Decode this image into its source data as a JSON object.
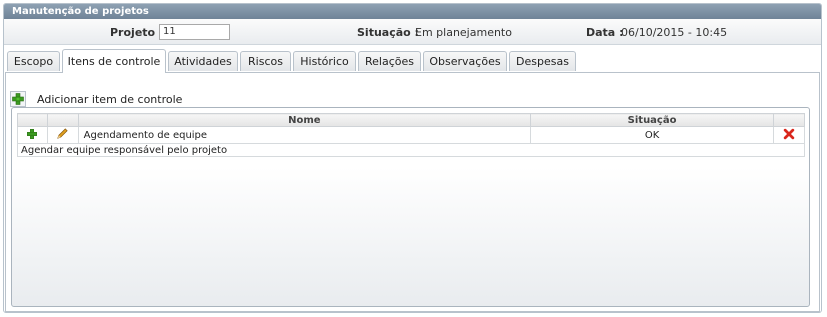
{
  "window": {
    "title": "Manutenção de projetos"
  },
  "info": {
    "projeto_label": "Projeto :",
    "projeto_value": "11",
    "situacao_label": "Situação :",
    "situacao_value": "Em planejamento",
    "data_label": "Data :",
    "data_value": "06/10/2015 - 10:45"
  },
  "tabs": [
    {
      "label": "Escopo"
    },
    {
      "label": "Itens de controle",
      "active": true
    },
    {
      "label": "Atividades"
    },
    {
      "label": "Riscos"
    },
    {
      "label": "Histórico"
    },
    {
      "label": "Relações"
    },
    {
      "label": "Observações"
    },
    {
      "label": "Despesas"
    }
  ],
  "toolbar": {
    "add_label": "Adicionar item de controle"
  },
  "table": {
    "headers": {
      "nome": "Nome",
      "situacao": "Situação"
    },
    "rows": [
      {
        "nome": "Agendamento de equipe",
        "situacao": "OK",
        "description": "Agendar equipe responsável pelo projeto"
      }
    ]
  },
  "colors": {
    "titlebar": "#7b8ea1",
    "link": "#2a5d84",
    "add_icon": "#3a9a20",
    "delete_icon": "#d9261c",
    "edit_icon": "#e0a020"
  }
}
